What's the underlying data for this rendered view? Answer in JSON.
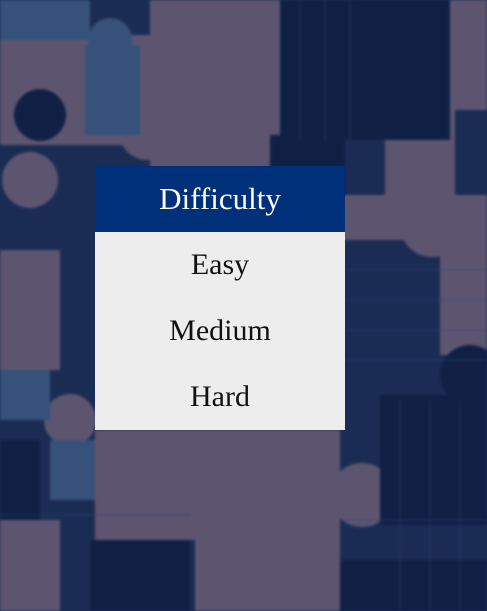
{
  "menu": {
    "title": "Difficulty",
    "options": [
      "Easy",
      "Medium",
      "Hard"
    ]
  },
  "colors": {
    "header": "#00307a",
    "panel": "#ededed",
    "background_dark": "#13264f",
    "background_piece": "#5e5670"
  },
  "background": {
    "subject": "blurred jigsaw puzzle pieces"
  }
}
